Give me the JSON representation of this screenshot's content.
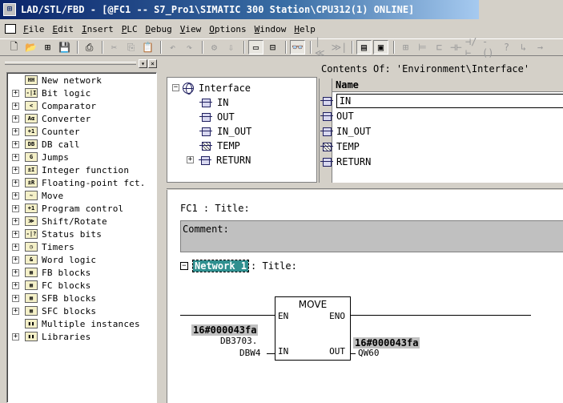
{
  "window": {
    "title": "LAD/STL/FBD  - [@FC1 -- S7_Pro1\\SIMATIC 300 Station\\CPU312(1)  ONLINE]",
    "app_icon": "ladder-app-icon"
  },
  "menu": [
    "File",
    "Edit",
    "Insert",
    "PLC",
    "Debug",
    "View",
    "Options",
    "Window",
    "Help"
  ],
  "toolbar": {
    "buttons": [
      {
        "name": "new-icon",
        "glyph": "🗋",
        "dim": false
      },
      {
        "name": "open-icon",
        "glyph": "📂",
        "dim": false
      },
      {
        "name": "accessible-nodes-icon",
        "glyph": "⊞",
        "dim": false
      },
      {
        "name": "save-icon",
        "glyph": "💾",
        "dim": true
      },
      {
        "name": "print-icon",
        "glyph": "⎙",
        "dim": false
      },
      {
        "name": "cut-icon",
        "glyph": "✂",
        "dim": true
      },
      {
        "name": "copy-icon",
        "glyph": "⎘",
        "dim": true
      },
      {
        "name": "paste-icon",
        "glyph": "📋",
        "dim": true
      },
      {
        "name": "undo-icon",
        "glyph": "↶",
        "dim": true
      },
      {
        "name": "redo-icon",
        "glyph": "↷",
        "dim": true
      },
      {
        "name": "compile-icon",
        "glyph": "⚙",
        "dim": true
      },
      {
        "name": "download-icon",
        "glyph": "⇩",
        "dim": true
      },
      {
        "name": "online-icon",
        "glyph": "▭",
        "dim": false,
        "pressed": true
      },
      {
        "name": "stop-icon",
        "glyph": "⊟",
        "dim": false
      },
      {
        "name": "monitor-icon",
        "glyph": "👓",
        "dim": false,
        "pressed": true
      },
      {
        "name": "prev-network-icon",
        "glyph": "|≪",
        "dim": true
      },
      {
        "name": "next-network-icon",
        "glyph": "≫|",
        "dim": true
      },
      {
        "name": "overview-icon",
        "glyph": "▤",
        "dim": false,
        "pressed": true
      },
      {
        "name": "details-icon",
        "glyph": "▣",
        "dim": false,
        "pressed": true
      },
      {
        "name": "new-network-icon",
        "glyph": "⊞",
        "dim": true
      },
      {
        "name": "branch-icon",
        "glyph": "⊨",
        "dim": true
      },
      {
        "name": "parallel-icon",
        "glyph": "⊏",
        "dim": true
      },
      {
        "name": "no-contact-icon",
        "glyph": "⊣⊢",
        "dim": true
      },
      {
        "name": "nc-contact-icon",
        "glyph": "⊣/⊢",
        "dim": true
      },
      {
        "name": "coil-icon",
        "glyph": "-()",
        "dim": true
      },
      {
        "name": "empty-box-icon",
        "glyph": "?",
        "dim": true
      },
      {
        "name": "open-branch-icon",
        "glyph": "↳",
        "dim": true
      },
      {
        "name": "close-branch-icon",
        "glyph": "→",
        "dim": true
      }
    ]
  },
  "elements": [
    {
      "label": "New network",
      "icon": "new-network-icon",
      "abbr": "HH",
      "expand": ""
    },
    {
      "label": "Bit logic",
      "icon": "bit-logic-icon",
      "abbr": "-|I",
      "expand": "+"
    },
    {
      "label": "Comparator",
      "icon": "comparator-icon",
      "abbr": "<",
      "expand": "+"
    },
    {
      "label": "Converter",
      "icon": "converter-icon",
      "abbr": "Aα",
      "expand": "+"
    },
    {
      "label": "Counter",
      "icon": "counter-icon",
      "abbr": "+1",
      "expand": "+"
    },
    {
      "label": "DB call",
      "icon": "db-call-icon",
      "abbr": "DB",
      "expand": "+"
    },
    {
      "label": "Jumps",
      "icon": "jumps-icon",
      "abbr": "G",
      "expand": "+"
    },
    {
      "label": "Integer function",
      "icon": "integer-function-icon",
      "abbr": "±I",
      "expand": "+"
    },
    {
      "label": "Floating-point fct.",
      "icon": "floating-point-icon",
      "abbr": "±R",
      "expand": "+"
    },
    {
      "label": "Move",
      "icon": "move-icon",
      "abbr": "~",
      "expand": "+"
    },
    {
      "label": "Program control",
      "icon": "program-control-icon",
      "abbr": "+1",
      "expand": "+"
    },
    {
      "label": "Shift/Rotate",
      "icon": "shift-rotate-icon",
      "abbr": "≫",
      "expand": "+"
    },
    {
      "label": "Status bits",
      "icon": "status-bits-icon",
      "abbr": "-|?",
      "expand": "+"
    },
    {
      "label": "Timers",
      "icon": "timers-icon",
      "abbr": "◷",
      "expand": "+"
    },
    {
      "label": "Word logic",
      "icon": "word-logic-icon",
      "abbr": "&",
      "expand": "+"
    },
    {
      "label": "FB blocks",
      "icon": "fb-blocks-icon",
      "abbr": "▦",
      "expand": "+"
    },
    {
      "label": "FC blocks",
      "icon": "fc-blocks-icon",
      "abbr": "▦",
      "expand": "+"
    },
    {
      "label": "SFB blocks",
      "icon": "sfb-blocks-icon",
      "abbr": "▦",
      "expand": "+"
    },
    {
      "label": "SFC blocks",
      "icon": "sfc-blocks-icon",
      "abbr": "▦",
      "expand": "+"
    },
    {
      "label": "Multiple instances",
      "icon": "multiple-instances-icon",
      "abbr": "▮▮",
      "expand": ""
    },
    {
      "label": "Libraries",
      "icon": "libraries-icon",
      "abbr": "▮▮",
      "expand": "+"
    }
  ],
  "interface_tree": {
    "root": "Interface",
    "children": [
      "IN",
      "OUT",
      "IN_OUT",
      "TEMP",
      "RETURN"
    ]
  },
  "contents": {
    "header": "Contents Of: 'Environment\\Interface'",
    "column": "Name",
    "rows": [
      "IN",
      "OUT",
      "IN_OUT",
      "TEMP",
      "RETURN"
    ]
  },
  "editor": {
    "block_title": "FC1 : Title:",
    "comment": "Comment:",
    "network_label": "Network 1",
    "network_title": ": Title:",
    "box": {
      "name": "MOVE",
      "en": "EN",
      "eno": "ENO",
      "in": "IN",
      "out": "OUT"
    },
    "in_value": "16#000043fa",
    "in_operand_line1": "DB3703.",
    "in_operand_line2": "DBW4",
    "out_value": "16#000043fa",
    "out_operand": "QW60"
  }
}
